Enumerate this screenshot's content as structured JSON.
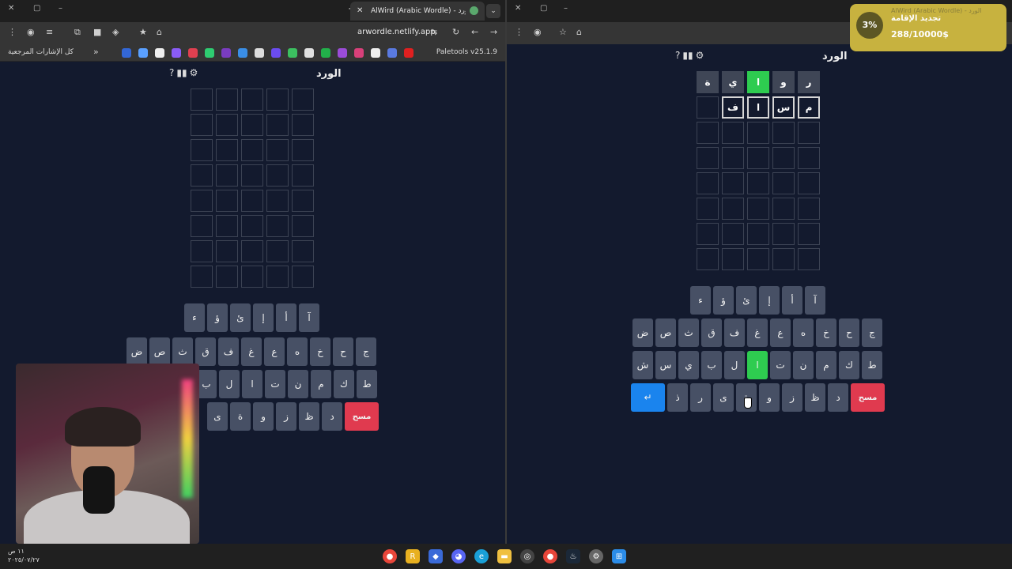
{
  "left_browser": {
    "tab_title": "AlWird (Arabic Wordle) - الورد",
    "tab_close": "✕",
    "new_tab": "+",
    "url": "arwordle.netlify.app",
    "bookmarks_folder": "كل الإشارات المرجعية",
    "bookmarks_overflow": "»",
    "paletools": "Paletools v25.1.9"
  },
  "right_browser": {
    "tab_close": "✕"
  },
  "game": {
    "title": "الورد",
    "icon_help": "?",
    "icon_stats": "▮▮",
    "icon_settings": "⚙"
  },
  "left_board": {
    "rows": [
      [
        "",
        "",
        "",
        "",
        ""
      ],
      [
        "",
        "",
        "",
        "",
        ""
      ],
      [
        "",
        "",
        "",
        "",
        ""
      ],
      [
        "",
        "",
        "",
        "",
        ""
      ],
      [
        "",
        "",
        "",
        "",
        ""
      ],
      [
        "",
        "",
        "",
        "",
        ""
      ],
      [
        "",
        "",
        "",
        "",
        ""
      ],
      [
        "",
        "",
        "",
        "",
        ""
      ]
    ]
  },
  "right_board": {
    "rows": [
      [
        {
          "l": "ر",
          "s": "gray"
        },
        {
          "l": "و",
          "s": "gray"
        },
        {
          "l": "ا",
          "s": "green"
        },
        {
          "l": "ي",
          "s": "gray"
        },
        {
          "l": "ة",
          "s": "gray"
        }
      ],
      [
        {
          "l": "م",
          "s": "typed"
        },
        {
          "l": "س",
          "s": "typed"
        },
        {
          "l": "ا",
          "s": "typed"
        },
        {
          "l": "ف",
          "s": "typed"
        },
        {
          "l": "",
          "s": "empty"
        }
      ],
      [
        {
          "l": "",
          "s": "empty"
        },
        {
          "l": "",
          "s": "empty"
        },
        {
          "l": "",
          "s": "empty"
        },
        {
          "l": "",
          "s": "empty"
        },
        {
          "l": "",
          "s": "empty"
        }
      ],
      [
        {
          "l": "",
          "s": "empty"
        },
        {
          "l": "",
          "s": "empty"
        },
        {
          "l": "",
          "s": "empty"
        },
        {
          "l": "",
          "s": "empty"
        },
        {
          "l": "",
          "s": "empty"
        }
      ],
      [
        {
          "l": "",
          "s": "empty"
        },
        {
          "l": "",
          "s": "empty"
        },
        {
          "l": "",
          "s": "empty"
        },
        {
          "l": "",
          "s": "empty"
        },
        {
          "l": "",
          "s": "empty"
        }
      ],
      [
        {
          "l": "",
          "s": "empty"
        },
        {
          "l": "",
          "s": "empty"
        },
        {
          "l": "",
          "s": "empty"
        },
        {
          "l": "",
          "s": "empty"
        },
        {
          "l": "",
          "s": "empty"
        }
      ],
      [
        {
          "l": "",
          "s": "empty"
        },
        {
          "l": "",
          "s": "empty"
        },
        {
          "l": "",
          "s": "empty"
        },
        {
          "l": "",
          "s": "empty"
        },
        {
          "l": "",
          "s": "empty"
        }
      ],
      [
        {
          "l": "",
          "s": "empty"
        },
        {
          "l": "",
          "s": "empty"
        },
        {
          "l": "",
          "s": "empty"
        },
        {
          "l": "",
          "s": "empty"
        },
        {
          "l": "",
          "s": "empty"
        }
      ]
    ]
  },
  "keyboard_left": {
    "row1": [
      "آ",
      "أ",
      "إ",
      "ئ",
      "ؤ",
      "ء"
    ],
    "row2": [
      "ج",
      "ح",
      "خ",
      "ه",
      "ع",
      "غ",
      "ف",
      "ق",
      "ث",
      "ص",
      "ض"
    ],
    "row3": [
      "ط",
      "ك",
      "م",
      "ن",
      "ت",
      "ا",
      "ل",
      "ب"
    ],
    "row4": [
      "مسح",
      "د",
      "ظ",
      "ز",
      "و",
      "ة",
      "ى"
    ]
  },
  "keyboard_right": {
    "row1": [
      "آ",
      "أ",
      "إ",
      "ئ",
      "ؤ",
      "ء"
    ],
    "row2": [
      "ج",
      "ح",
      "خ",
      "ه",
      "ع",
      "غ",
      "ف",
      "ق",
      "ث",
      "ص",
      "ض"
    ],
    "row3": [
      "ط",
      "ك",
      "م",
      "ن",
      "ت",
      "ا",
      "ل",
      "ب",
      "ي",
      "س",
      "ش"
    ],
    "row4": [
      "مسح",
      "د",
      "ظ",
      "ز",
      "و",
      "ة",
      "ى",
      "ر",
      "ذ",
      "↵"
    ]
  },
  "notification": {
    "percent": "3%",
    "title": "تجديد الإقامة",
    "amount": "288/10000$",
    "bg_tab": "AlWird (Arabic Wordle) - الورد"
  },
  "taskbar": {
    "time": "١١ ص",
    "date": "٢٠٢٥/٠٧/٢٧"
  },
  "colors": {
    "background": "#131a2e",
    "key": "#475065",
    "correct": "#2ecc50",
    "delete": "#e03a4f",
    "enter": "#1a84ee"
  }
}
